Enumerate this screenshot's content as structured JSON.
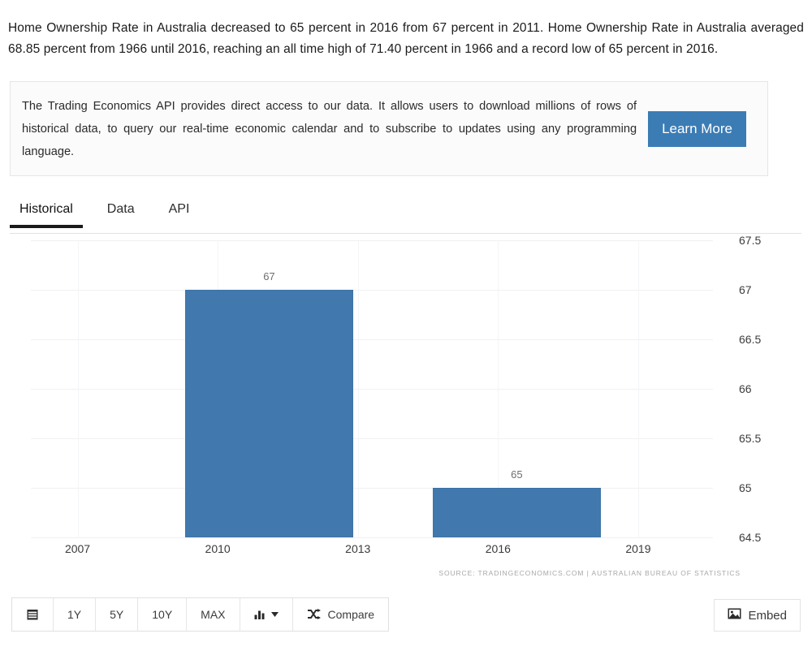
{
  "intro": {
    "text": "Home Ownership Rate in Australia decreased to 65 percent in 2016 from 67 percent in 2011. Home Ownership Rate in Australia averaged 68.85 percent from 1966 until 2016, reaching an all time high of 71.40 percent in 1966 and a record low of 65 percent in 2016."
  },
  "api_banner": {
    "text": "The Trading Economics API provides direct access to our data. It allows users to download millions of rows of historical data, to query our real-time economic calendar and to subscribe to updates using any programming language.",
    "button_label": "Learn More",
    "button_color": "#3b7cb5"
  },
  "tabs": [
    {
      "label": "Historical",
      "active": true
    },
    {
      "label": "Data",
      "active": false
    },
    {
      "label": "API",
      "active": false
    }
  ],
  "chart_data": {
    "type": "bar",
    "title": "",
    "subtitle": "",
    "xlabel": "",
    "ylabel": "",
    "categories": [
      "2011",
      "2016"
    ],
    "values": [
      67,
      65
    ],
    "data_labels": [
      "67",
      "65"
    ],
    "bar_color": "#4178ae",
    "x": [
      2011,
      2016
    ],
    "bar_spans": [
      [
        2009.3,
        2012.9
      ],
      [
        2014.6,
        2018.2
      ]
    ],
    "xlim": [
      2006.0,
      2020.6
    ],
    "ylim": [
      64.5,
      67.5
    ],
    "ytick_labels": [
      "67.5",
      "67",
      "66.5",
      "66",
      "65.5",
      "65",
      "64.5"
    ],
    "ytick_values": [
      67.5,
      67,
      66.5,
      66,
      65.5,
      65,
      64.5
    ],
    "xtick_labels": [
      "2007",
      "2010",
      "2013",
      "2016",
      "2019"
    ],
    "xtick_values": [
      2007,
      2010,
      2013,
      2016,
      2019
    ],
    "grid": true,
    "legend": "none",
    "source": "SOURCE: TRADINGECONOMICS.COM  |  AUSTRALIAN BUREAU OF STATISTICS"
  },
  "toolbar": {
    "range_buttons": [
      "1Y",
      "5Y",
      "10Y",
      "MAX"
    ],
    "compare_label": "Compare",
    "calendar_icon": "calendar-icon",
    "chart_type_icon": "bar-chart-icon",
    "caret_icon": "caret-down-icon",
    "shuffle_icon": "shuffle-icon"
  },
  "embed": {
    "label": "Embed",
    "icon": "image-icon"
  }
}
